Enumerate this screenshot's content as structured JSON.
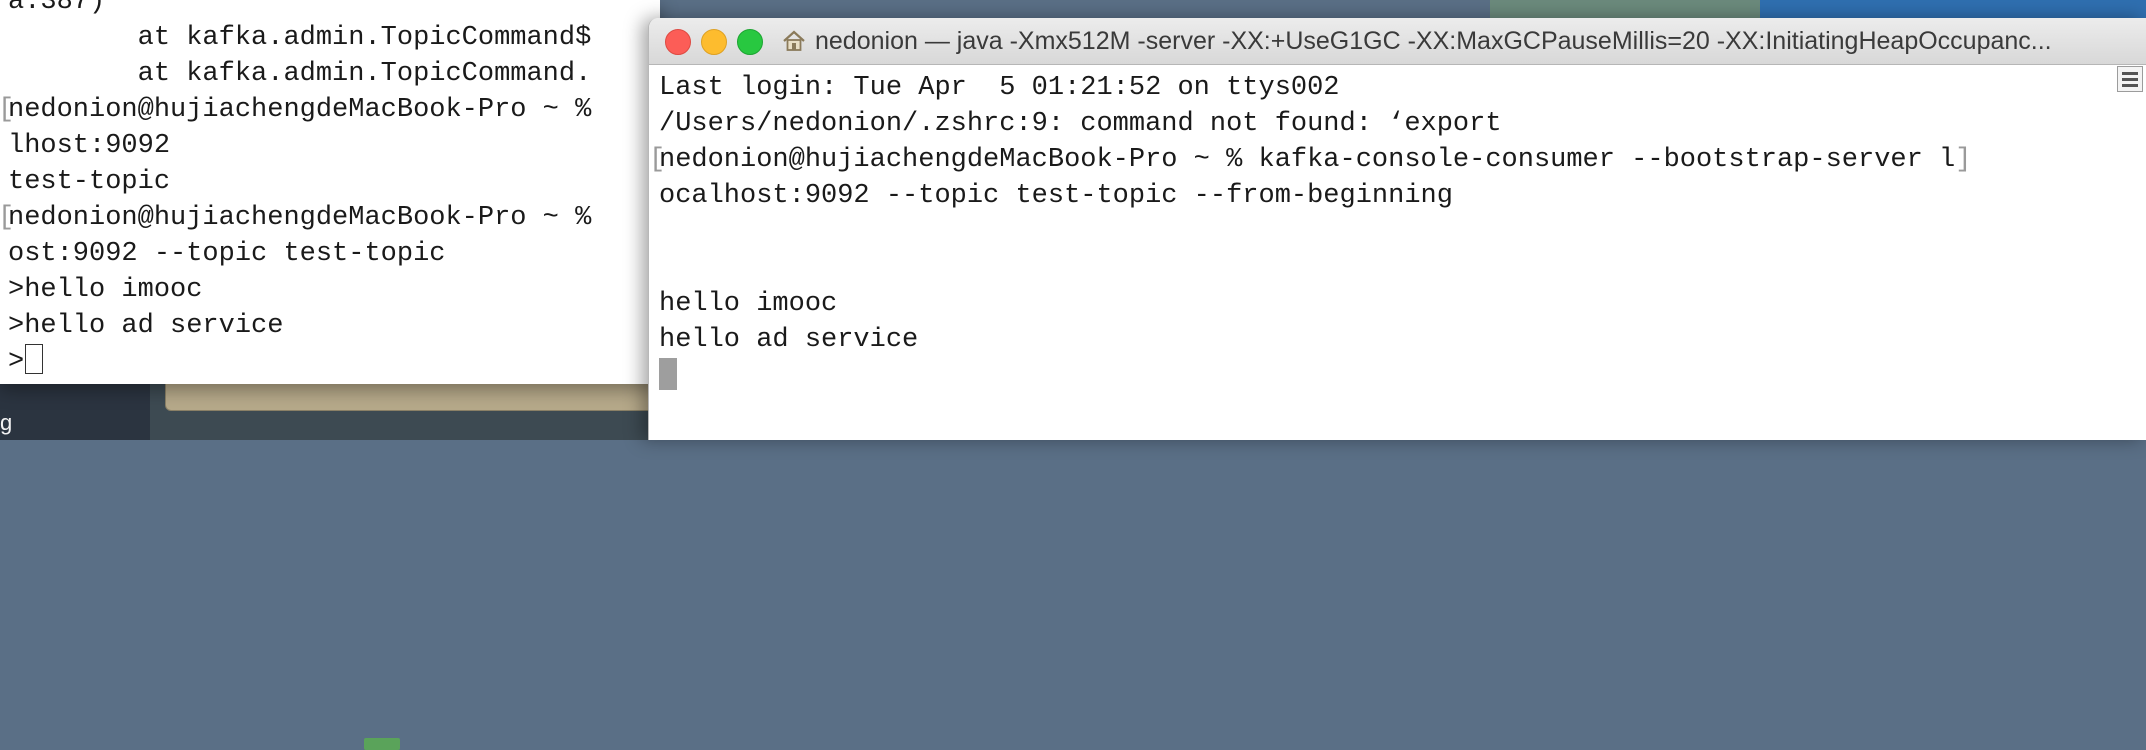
{
  "desktop": {
    "label": "g"
  },
  "back_terminal": {
    "lines": [
      {
        "text": "a:387)",
        "bracket": false
      },
      {
        "text": "        at kafka.admin.TopicCommand$",
        "bracket": false
      },
      {
        "text": "        at kafka.admin.TopicCommand.",
        "bracket": false
      },
      {
        "text": "nedonion@hujiachengdeMacBook-Pro ~ %",
        "bracket": true
      },
      {
        "text": "lhost:9092",
        "bracket": false
      },
      {
        "text": "test-topic",
        "bracket": false
      },
      {
        "text": "nedonion@hujiachengdeMacBook-Pro ~ %",
        "bracket": true
      },
      {
        "text": "ost:9092 --topic test-topic",
        "bracket": false
      },
      {
        "text": ">hello imooc",
        "bracket": false
      },
      {
        "text": ">hello ad service",
        "bracket": false
      }
    ],
    "input_prompt": ">"
  },
  "front_terminal": {
    "title": "nedonion — java -Xmx512M -server -XX:+UseG1GC -XX:MaxGCPauseMillis=20 -XX:InitiatingHeapOccupanc...",
    "lines": [
      {
        "text": "Last login: Tue Apr  5 01:21:52 on ttys002",
        "bracket": false
      },
      {
        "text": "/Users/nedonion/.zshrc:9: command not found: ‘export",
        "bracket": false
      },
      {
        "text": "nedonion@hujiachengdeMacBook-Pro ~ % kafka-console-consumer --bootstrap-server l",
        "bracket": true,
        "bracket_end": true
      },
      {
        "text": "ocalhost:9092 --topic test-topic --from-beginning",
        "bracket": false
      },
      {
        "text": "",
        "bracket": false
      },
      {
        "text": "",
        "bracket": false
      },
      {
        "text": "hello imooc",
        "bracket": false
      },
      {
        "text": "hello ad service",
        "bracket": false
      }
    ]
  },
  "colors": {
    "close": "#fc5d57",
    "minimize": "#fdbc2e",
    "maximize": "#28c840"
  },
  "icons": {
    "home": "home-icon",
    "scroll": "scroll-marks-icon"
  }
}
